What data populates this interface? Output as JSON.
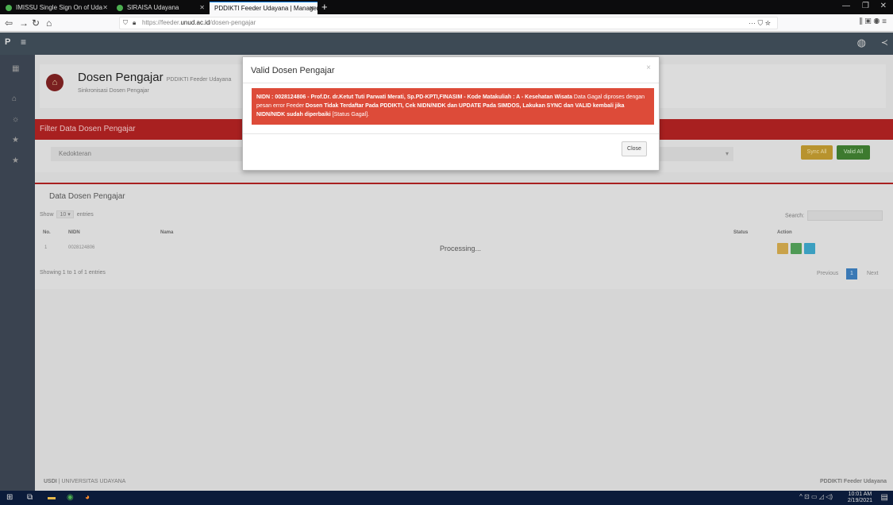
{
  "browser": {
    "tabs": [
      {
        "title": "IMISSU Single Sign On of Uda"
      },
      {
        "title": "SIRAISA Udayana"
      },
      {
        "title": "PDDIKTI Feeder Udayana | Manager"
      }
    ],
    "url_prefix": "https://feeder.",
    "url_domain": "unud.ac.id",
    "url_path": "/dosen-pengajar"
  },
  "app": {
    "brand": "P",
    "page_title": "Dosen Pengajar",
    "page_title_small": "PDDIKTI Feeder Udayana",
    "page_subtitle": "Sinkronisasi Dosen Pengajar"
  },
  "filter": {
    "heading": "Filter Data Dosen Pengajar",
    "select_value": "Kedokteran",
    "sync_all_label": "Sync All",
    "valid_all_label": "Valid All"
  },
  "table": {
    "heading": "Data Dosen Pengajar",
    "show_prefix": "Show",
    "show_value": "10",
    "show_suffix": "entries",
    "search_label": "Search:",
    "columns": {
      "no": "No.",
      "nidn": "NIDN",
      "nama": "Nama",
      "status": "Status",
      "action": "Action"
    },
    "row": {
      "no": "1",
      "nidn": "0028124806"
    },
    "processing": "Processing...",
    "showing": "Showing 1 to 1 of 1 entries",
    "prev": "Previous",
    "page": "1",
    "next": "Next"
  },
  "modal": {
    "title": "Valid Dosen Pengajar",
    "close_x": "×",
    "alert_part1": "NIDN : 0028124806 - Prof.Dr. dr.Ketut Tuti Parwati Merati, Sp.PD-KPTI,FINASIM - Kode Matakuliah : A - Kesehatan Wisata",
    "alert_part2": " Data Gagal diproses dengan pesan error Feeder ",
    "alert_part3": "Dosen Tidak Terdaftar Pada PDDIKTI, Cek NIDN/NIDK dan UPDATE Pada SIMDOS, Lakukan SYNC dan VALID kembali jika NIDN/NIDK sudah diperbaiki",
    "alert_part4": " [Status Gagal].",
    "close_label": "Close"
  },
  "footer": {
    "left_bold": "USDI",
    "left_rest": " | UNIVERSITAS UDAYANA",
    "right": "PDDIKTI Feeder Udayana"
  },
  "taskbar": {
    "time": "10:01 AM",
    "date": "2/19/2021"
  }
}
